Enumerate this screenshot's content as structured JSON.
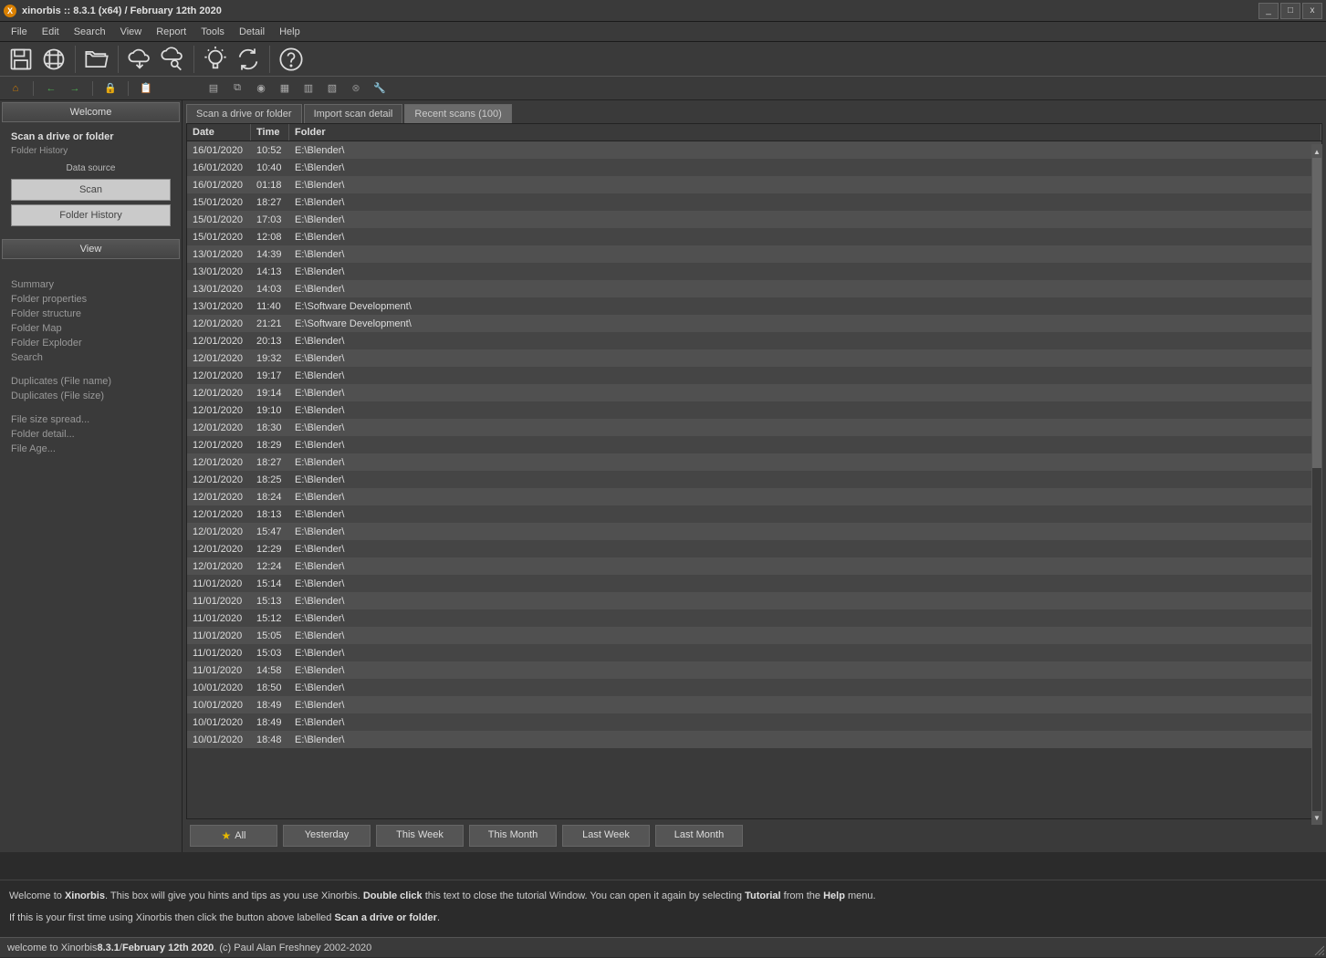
{
  "title": "xinorbis :: 8.3.1 (x64) / February 12th 2020",
  "menu": [
    "File",
    "Edit",
    "Search",
    "View",
    "Report",
    "Tools",
    "Detail",
    "Help"
  ],
  "sidebar": {
    "welcome": "Welcome",
    "scan_title": "Scan a drive or folder",
    "folder_history": "Folder History",
    "data_source": "Data source",
    "btn_scan": "Scan",
    "btn_history": "Folder History",
    "view_title": "View",
    "links1": [
      "Summary",
      "Folder properties",
      "Folder structure",
      "Folder Map",
      "Folder Exploder",
      "Search"
    ],
    "links2": [
      "Duplicates (File name)",
      "Duplicates (File size)"
    ],
    "links3": [
      "File size spread...",
      "Folder detail...",
      "File Age..."
    ]
  },
  "tabs": [
    {
      "label": "Scan a drive or folder",
      "active": false
    },
    {
      "label": "Import scan detail",
      "active": false
    },
    {
      "label": "Recent scans (100)",
      "active": true
    }
  ],
  "columns": {
    "date": "Date",
    "time": "Time",
    "folder": "Folder"
  },
  "rows": [
    {
      "date": "16/01/2020",
      "time": "10:52",
      "folder": "E:\\Blender\\"
    },
    {
      "date": "16/01/2020",
      "time": "10:40",
      "folder": "E:\\Blender\\"
    },
    {
      "date": "16/01/2020",
      "time": "01:18",
      "folder": "E:\\Blender\\"
    },
    {
      "date": "15/01/2020",
      "time": "18:27",
      "folder": "E:\\Blender\\"
    },
    {
      "date": "15/01/2020",
      "time": "17:03",
      "folder": "E:\\Blender\\"
    },
    {
      "date": "15/01/2020",
      "time": "12:08",
      "folder": "E:\\Blender\\"
    },
    {
      "date": "13/01/2020",
      "time": "14:39",
      "folder": "E:\\Blender\\"
    },
    {
      "date": "13/01/2020",
      "time": "14:13",
      "folder": "E:\\Blender\\"
    },
    {
      "date": "13/01/2020",
      "time": "14:03",
      "folder": "E:\\Blender\\"
    },
    {
      "date": "13/01/2020",
      "time": "11:40",
      "folder": "E:\\Software Development\\"
    },
    {
      "date": "12/01/2020",
      "time": "21:21",
      "folder": "E:\\Software Development\\"
    },
    {
      "date": "12/01/2020",
      "time": "20:13",
      "folder": "E:\\Blender\\"
    },
    {
      "date": "12/01/2020",
      "time": "19:32",
      "folder": "E:\\Blender\\"
    },
    {
      "date": "12/01/2020",
      "time": "19:17",
      "folder": "E:\\Blender\\"
    },
    {
      "date": "12/01/2020",
      "time": "19:14",
      "folder": "E:\\Blender\\"
    },
    {
      "date": "12/01/2020",
      "time": "19:10",
      "folder": "E:\\Blender\\"
    },
    {
      "date": "12/01/2020",
      "time": "18:30",
      "folder": "E:\\Blender\\"
    },
    {
      "date": "12/01/2020",
      "time": "18:29",
      "folder": "E:\\Blender\\"
    },
    {
      "date": "12/01/2020",
      "time": "18:27",
      "folder": "E:\\Blender\\"
    },
    {
      "date": "12/01/2020",
      "time": "18:25",
      "folder": "E:\\Blender\\"
    },
    {
      "date": "12/01/2020",
      "time": "18:24",
      "folder": "E:\\Blender\\"
    },
    {
      "date": "12/01/2020",
      "time": "18:13",
      "folder": "E:\\Blender\\"
    },
    {
      "date": "12/01/2020",
      "time": "15:47",
      "folder": "E:\\Blender\\"
    },
    {
      "date": "12/01/2020",
      "time": "12:29",
      "folder": "E:\\Blender\\"
    },
    {
      "date": "12/01/2020",
      "time": "12:24",
      "folder": "E:\\Blender\\"
    },
    {
      "date": "11/01/2020",
      "time": "15:14",
      "folder": "E:\\Blender\\"
    },
    {
      "date": "11/01/2020",
      "time": "15:13",
      "folder": "E:\\Blender\\"
    },
    {
      "date": "11/01/2020",
      "time": "15:12",
      "folder": "E:\\Blender\\"
    },
    {
      "date": "11/01/2020",
      "time": "15:05",
      "folder": "E:\\Blender\\"
    },
    {
      "date": "11/01/2020",
      "time": "15:03",
      "folder": "E:\\Blender\\"
    },
    {
      "date": "11/01/2020",
      "time": "14:58",
      "folder": "E:\\Blender\\"
    },
    {
      "date": "10/01/2020",
      "time": "18:50",
      "folder": "E:\\Blender\\"
    },
    {
      "date": "10/01/2020",
      "time": "18:49",
      "folder": "E:\\Blender\\"
    },
    {
      "date": "10/01/2020",
      "time": "18:49",
      "folder": "E:\\Blender\\"
    },
    {
      "date": "10/01/2020",
      "time": "18:48",
      "folder": "E:\\Blender\\"
    }
  ],
  "filters": [
    "All",
    "Yesterday",
    "This Week",
    "This Month",
    "Last Week",
    "Last Month"
  ],
  "tutorial": {
    "l1a": "Welcome to ",
    "l1b": "Xinorbis",
    "l1c": ". This box will give you hints and tips as you use Xinorbis. ",
    "l1d": "Double click",
    "l1e": " this text to close the tutorial Window. You can open it again by selecting ",
    "l1f": "Tutorial",
    "l1g": " from the ",
    "l1h": "Help",
    "l1i": " menu.",
    "l2a": "If this is your first time using Xinorbis then click the button above labelled ",
    "l2b": "Scan a drive or folder",
    "l2c": "."
  },
  "status": {
    "a": "welcome to Xinorbis ",
    "b": "8.3.1",
    "c": " / ",
    "d": "February 12th 2020",
    "e": ". (c) Paul Alan Freshney 2002-2020"
  }
}
